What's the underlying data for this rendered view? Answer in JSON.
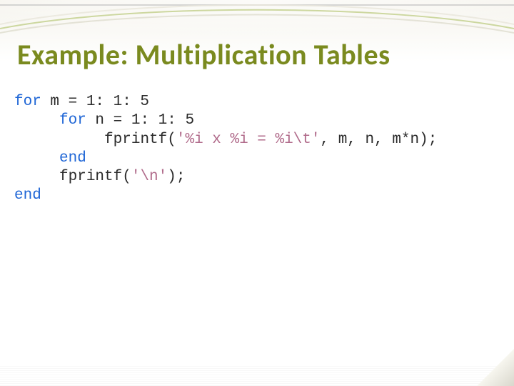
{
  "title": "Example: Multiplication Tables",
  "code": {
    "l1_kw": "for",
    "l1_rest": " m = 1: 1: 5",
    "l2_indent": "     ",
    "l2_kw": "for",
    "l2_rest": " n = 1: 1: 5",
    "l3_indent": "          ",
    "l3_fn": "fprintf(",
    "l3_str": "'%i x %i = %i\\t'",
    "l3_rest": ", m, n, m*n);",
    "l4_indent": "     ",
    "l4_kw": "end",
    "l5_indent": "     ",
    "l5_fn": "fprintf(",
    "l5_str": "'\\n'",
    "l5_rest": ");",
    "l6_kw": "end"
  }
}
